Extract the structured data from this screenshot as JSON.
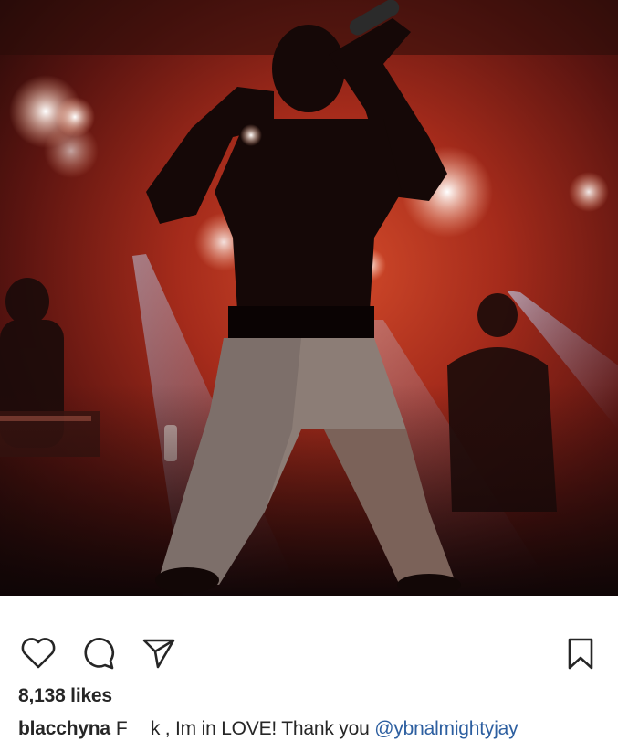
{
  "post": {
    "likes_text": "8,138 likes",
    "caption": {
      "username": "blacchyna",
      "text_censored_start": "F",
      "text_censored_end": "k , Im in LOVE! Thank you",
      "mention": "@ybnalmightyjay"
    }
  },
  "icons": {
    "like": "heart-icon",
    "comment": "comment-bubble-icon",
    "share": "paper-plane-icon",
    "save": "bookmark-icon"
  },
  "colors": {
    "text": "#262626",
    "mention": "#2d5fa0",
    "photo_warm": "#b8321f",
    "photo_dark": "#1a0a08"
  }
}
